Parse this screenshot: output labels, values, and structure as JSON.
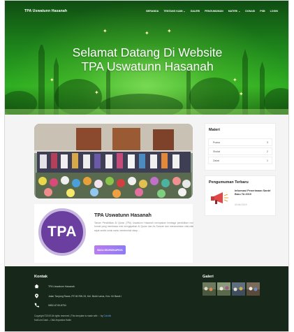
{
  "header": {
    "brand": "TPA Uswatunn Hasanah",
    "menu": [
      "BERANDA",
      "TENTANG KAMI ⌄",
      "GALERI",
      "PENGUMUMAN",
      "MATERI ⌄",
      "DONASI",
      "PSB",
      "LOGIN"
    ],
    "hero_line1": "Selamat Datang Di Website",
    "hero_line2": "TPA Uswatunn Hasanah"
  },
  "about": {
    "logo_text": "TPA",
    "title": "TPA Uswatunn Hasanah",
    "text": "Taman Pendidikan Al Quran (TPA) Uswatunn Hasanah merupakan lembaga pendidikan non formal yang membawa misi mengajarkan Al Quran dan As Sunnah dan menanamkan nilai-nilai sejak sedini untuk santu membentuk sikap ...",
    "button": "BACA SELENGKAPNYA"
  },
  "sidebar": {
    "materi_title": "Materi",
    "materi": [
      {
        "label": "Puasa",
        "count": "3"
      },
      {
        "label": "Sholat",
        "count": "2"
      },
      {
        "label": "Zakat",
        "count": "1"
      }
    ],
    "announce_title": "Pengumuman Terbaru",
    "announce_item": "Informasi Penerimaan Santri Baru TA 2019",
    "announce_date": "04 Mei 2019"
  },
  "footer": {
    "contact_title": "Kontak",
    "contact": [
      "TPA Uswatunn Hasanah",
      "Jalan Tanjung Rawa, RT.06 RW.15, Kel. Bukit Lama, Kec. Ilir Barat I",
      "0852-6749-8754"
    ],
    "gallery_title": "Galeri",
    "copyright_1": "Copyright ©2019 All rights reserved | This template is made with ♡ by",
    "copyright_link": "Colorlib",
    "copyright_2": "KatCom Dash – Okki Anyandra Halim"
  },
  "colors": {
    "accent": "#6b3fa0",
    "hero_green": "#2fae22",
    "footer_bg": "#17271a",
    "button": "#a37df2"
  }
}
